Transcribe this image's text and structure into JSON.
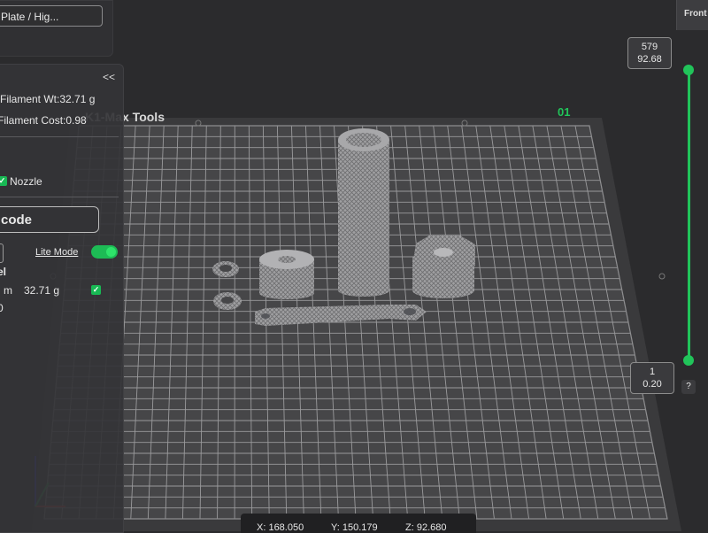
{
  "plate_selector": {
    "label": "Plate / Hig..."
  },
  "sliced_info": {
    "collapse_label": "<<",
    "filament_weight": "Filament Wt:32.71 g",
    "filament_cost": "Filament Cost:0.98",
    "nozzle_label": "Nozzle",
    "export_button": "code",
    "lite_mode_label": "Lite Mode",
    "table_header": "el",
    "row_unit": "m",
    "row_weight": "32.71 g",
    "row_zero": "0"
  },
  "bed": {
    "label": "K1-Max Tools",
    "plate_number": "01"
  },
  "view": {
    "front_label": "Front"
  },
  "layer_slider": {
    "top_layer": "579",
    "top_height": "92.68",
    "bottom_layer": "1",
    "bottom_height": "0.20",
    "help_label": "?"
  },
  "coordinates": {
    "x": "X: 168.050",
    "y": "Y: 150.179",
    "z": "Z: 92.680"
  },
  "colors": {
    "accent": "#21c45a",
    "background": "#2b2b2d",
    "bed_grid": "#9a9a9c"
  }
}
